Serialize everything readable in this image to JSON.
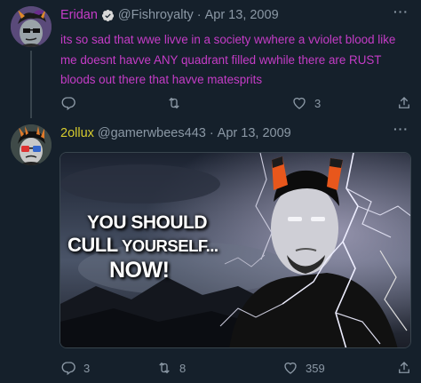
{
  "colors": {
    "background": "#15202b",
    "muted": "#8b98a5",
    "eridan_purple": "#c53cc7",
    "sollux_yellow": "#d6cb2e",
    "divider": "#38444d"
  },
  "tweets": [
    {
      "name": "Eridan",
      "verified": true,
      "handle": "@Fishroyalty",
      "separator": "·",
      "date": "Apr 13, 2009",
      "more_icon": "more-horizontal-icon",
      "text": "its so sad that wwe livve in a society wwhere a vviolet blood like me doesnt havve ANY quadrant filled wwhile there are RUST bloods out there that havve matesprits",
      "actions": {
        "replies": "",
        "retweets": "",
        "likes": "3"
      }
    },
    {
      "name": "2ollux",
      "handle": "@gamerwbees443",
      "separator": "·",
      "date": "Apr 13, 2009",
      "more_icon": "more-horizontal-icon",
      "media": {
        "line1": "YOU SHOULD",
        "line2_a": "CULL",
        "line2_b": " YOURSELF...",
        "line3": "NOW!"
      },
      "actions": {
        "replies": "3",
        "retweets": "8",
        "likes": "359"
      }
    }
  ]
}
